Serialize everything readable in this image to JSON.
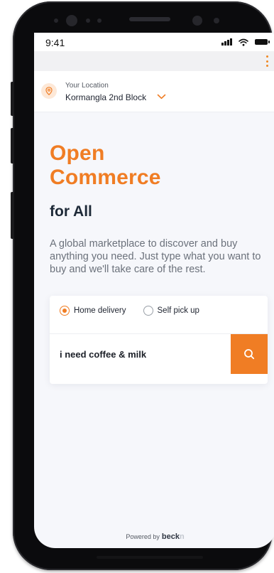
{
  "status_bar": {
    "time": "9:41"
  },
  "location": {
    "label": "Your Location",
    "value": "Kormangla 2nd Block",
    "pin_icon": "location-pin-icon",
    "chevron_icon": "chevron-down-icon"
  },
  "hero": {
    "title_line1": "Open",
    "title_line2": "Commerce",
    "subtitle": "for All",
    "description": "A global marketplace to discover and buy anything you need. Just type what you want to buy and we'll take care of the rest."
  },
  "delivery": {
    "options": [
      {
        "label": "Home delivery",
        "selected": true
      },
      {
        "label": "Self pick up",
        "selected": false
      }
    ]
  },
  "search": {
    "value": "i need coffee & milk",
    "button_icon": "search-icon"
  },
  "footer": {
    "powered_by": "Powered by",
    "brand_main": "beck",
    "brand_tail": "n"
  },
  "colors": {
    "accent": "#f07d24",
    "dark_text": "#1e2a38",
    "muted_text": "#6b717b",
    "background": "#f6f7fb"
  }
}
